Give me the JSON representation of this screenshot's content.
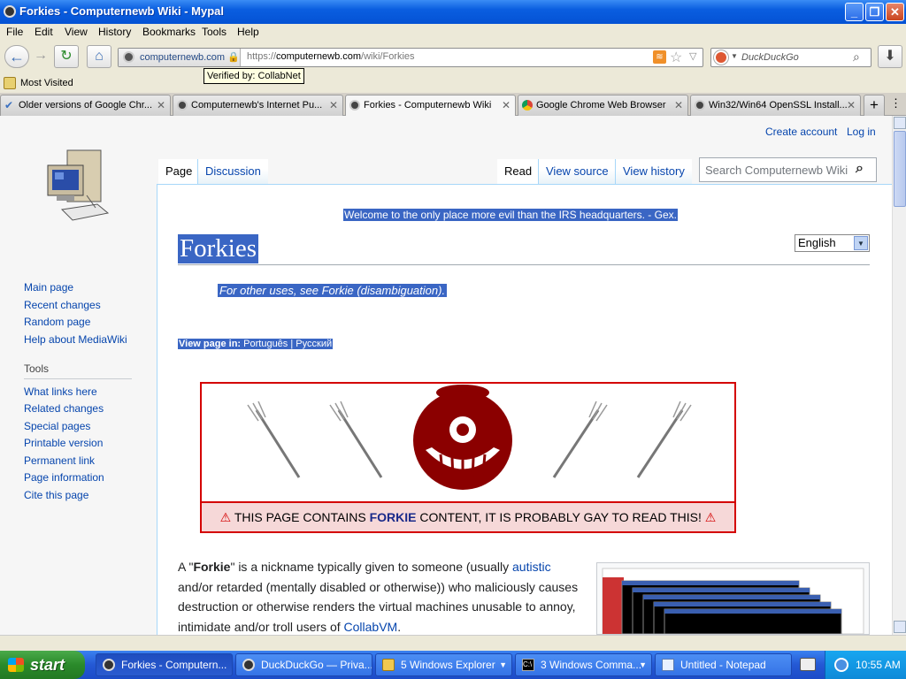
{
  "window": {
    "title": "Forkies - Computernewb Wiki - Mypal"
  },
  "menu": [
    "File",
    "Edit",
    "View",
    "History",
    "Bookmarks",
    "Tools",
    "Help"
  ],
  "nav": {
    "identity_label": "computernewb.com",
    "url_prefix": "https://",
    "url_host": "computernewb.com",
    "url_path": "/wiki/Forkies",
    "tooltip": "Verified by: CollabNet",
    "search_placeholder": "DuckDuckGo"
  },
  "bookmarks": {
    "most_visited": "Most Visited"
  },
  "tabs": [
    {
      "label": "Older versions of Google Chr..."
    },
    {
      "label": "Computernewb's Internet Pu..."
    },
    {
      "label": "Forkies - Computernewb Wiki"
    },
    {
      "label": "Google Chrome Web Browser"
    },
    {
      "label": "Win32/Win64 OpenSSL Install..."
    }
  ],
  "wiki": {
    "create_account": "Create account",
    "login": "Log in",
    "tab_page": "Page",
    "tab_discussion": "Discussion",
    "tab_read": "Read",
    "tab_view_source": "View source",
    "tab_view_history": "View history",
    "search_placeholder": "Search Computernewb Wiki",
    "nav_links": [
      "Main page",
      "Recent changes",
      "Random page",
      "Help about MediaWiki"
    ],
    "tools_heading": "Tools",
    "tools_links": [
      "What links here",
      "Related changes",
      "Special pages",
      "Printable version",
      "Permanent link",
      "Page information",
      "Cite this page"
    ],
    "tagline": "Welcome to the only place more evil than the IRS headquarters. - Gex.",
    "heading": "Forkies",
    "language": "English",
    "hatnote": "For other uses, see Forkie (disambiguation).",
    "view_in_label": "View page in:",
    "view_in_pt": "Português",
    "view_in_ru": "Русский",
    "warn_pre": "THIS PAGE CONTAINS",
    "warn_bold": "FORKIE",
    "warn_post": "CONTENT, IT IS PROBABLY GAY TO READ THIS!",
    "para_1": "A \"",
    "para_bold": "Forkie",
    "para_2": "\" is a nickname typically given to someone (usually ",
    "para_link1": "autistic",
    "para_3": " and/or retarded (mentally disabled or otherwise)) who maliciously causes destruction or otherwise renders the virtual machines unusable to annoy, intimidate and/or troll users of ",
    "para_link2": "CollabVM",
    "para_4": "."
  },
  "taskbar": {
    "start": "start",
    "items": [
      {
        "label": "Forkies - Computern..."
      },
      {
        "label": "DuckDuckGo — Priva..."
      },
      {
        "label": "5 Windows Explorer"
      },
      {
        "label": "3 Windows Comma..."
      },
      {
        "label": "Untitled - Notepad"
      }
    ],
    "clock": "10:55 AM"
  },
  "colors": {
    "accent": "#0452d4",
    "link": "#0645ad",
    "warning_red": "#d40000",
    "highlight": "#3a66c4"
  }
}
